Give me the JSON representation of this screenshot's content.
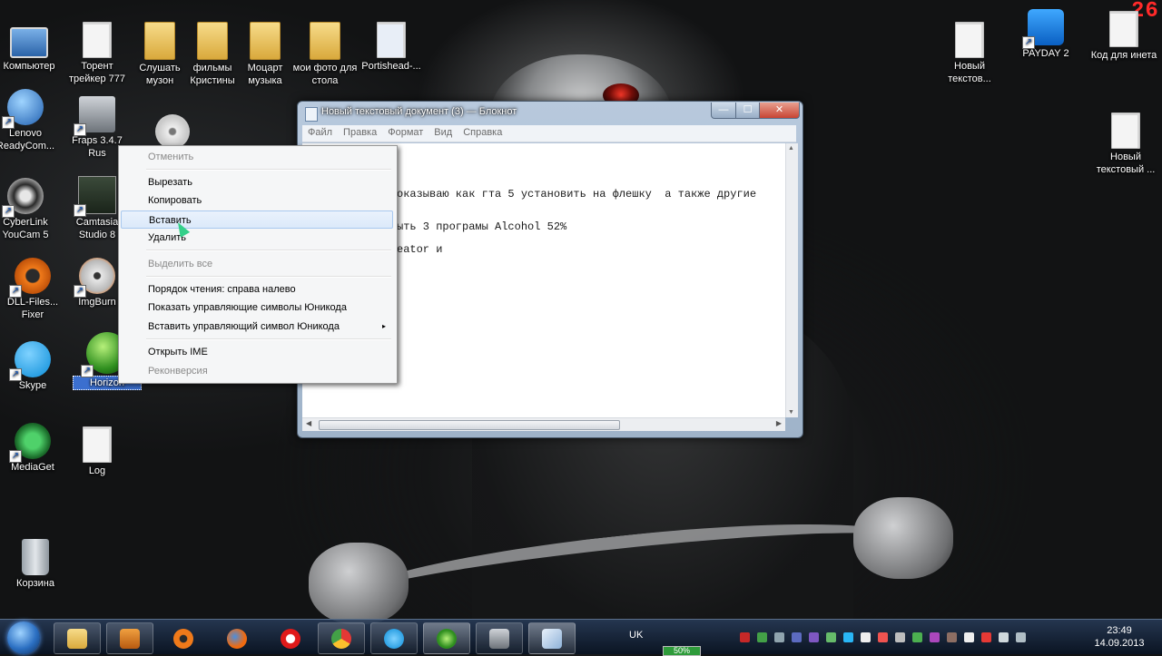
{
  "desktop_icons": [
    {
      "label": "Компьютер",
      "icon": "computer-icon"
    },
    {
      "label": "Торент трейкер 777",
      "icon": "file-icon"
    },
    {
      "label": "Слушать музон",
      "icon": "folder-icon"
    },
    {
      "label": "фильмы Кристины",
      "icon": "folder-icon"
    },
    {
      "label": "Моцарт музыка",
      "icon": "folder-icon"
    },
    {
      "label": "мои фото для стола",
      "icon": "folder-icon"
    },
    {
      "label": "Portishead-...",
      "icon": "audio-file-icon"
    },
    {
      "label": "Lenovo ReadyCom...",
      "icon": "lenovo-r-icon"
    },
    {
      "label": "Fraps 3.4.7 Rus",
      "icon": "fraps-icon"
    },
    {
      "label": "CyberLink YouCam 5",
      "icon": "webcam-icon"
    },
    {
      "label": "Camtasia Studio 8",
      "icon": "camtasia-icon"
    },
    {
      "label": "DLL-Files... Fixer",
      "icon": "gear-icon"
    },
    {
      "label": "ImgBurn",
      "icon": "disc-icon"
    },
    {
      "label": "Skype",
      "icon": "skype-icon"
    },
    {
      "label": "Horizon",
      "icon": "xbox-icon"
    },
    {
      "label": "MediaGet",
      "icon": "download-icon"
    },
    {
      "label": "Log",
      "icon": "file-icon"
    },
    {
      "label": "Корзина",
      "icon": "recycle-bin-icon"
    },
    {
      "label": "Новый текстов...",
      "icon": "file-icon"
    },
    {
      "label": "PAYDAY 2",
      "icon": "payday-icon"
    },
    {
      "label": "Код для инета",
      "icon": "file-icon"
    },
    {
      "label": "Новый текстовый ...",
      "icon": "file-icon"
    }
  ],
  "notepad": {
    "title": "Новый текстовый документ (3) — Блокнот",
    "menu": [
      "Файл",
      "Правка",
      "Формат",
      "Вид",
      "Справка"
    ],
    "lines": [
      "оказываю как гта 5 установить на флешку  а также другие",
      "ыть 3 програмы Alcohol 52%",
      "eator и"
    ],
    "controls": {
      "minimize": "—",
      "maximize": "☐",
      "close": "✕"
    }
  },
  "context_menu": {
    "items": [
      {
        "label": "Отменить",
        "enabled": false
      },
      {
        "label": "Вырезать",
        "enabled": true
      },
      {
        "label": "Копировать",
        "enabled": true
      },
      {
        "label": "Вставить",
        "enabled": true,
        "highlighted": true
      },
      {
        "label": "Удалить",
        "enabled": true
      },
      {
        "label": "Выделить все",
        "enabled": false
      },
      {
        "label": "Порядок чтения: справа налево",
        "enabled": true
      },
      {
        "label": "Показать управляющие символы Юникода",
        "enabled": true
      },
      {
        "label": "Вставить управляющий символ Юникода",
        "enabled": true,
        "submenu": true
      },
      {
        "label": "Открыть IME",
        "enabled": true
      },
      {
        "label": "Реконверсия",
        "enabled": false
      }
    ],
    "submenu_arrow": "▸"
  },
  "taskbar": {
    "language": "UK",
    "time": "23:49",
    "date": "14.09.2013",
    "battery": "50%",
    "apps": [
      "explorer-icon",
      "media-player-icon",
      "gear-icon",
      "firefox-icon",
      "opera-icon",
      "chrome-icon",
      "skype-icon",
      "xbox-icon",
      "fraps-icon",
      "notepad-icon"
    ]
  },
  "fps_counter": "26",
  "colors": {
    "accent_selection": "#3b6fcf",
    "menu_highlight": "#dbe9fa",
    "fps": "#ff2a2a"
  }
}
